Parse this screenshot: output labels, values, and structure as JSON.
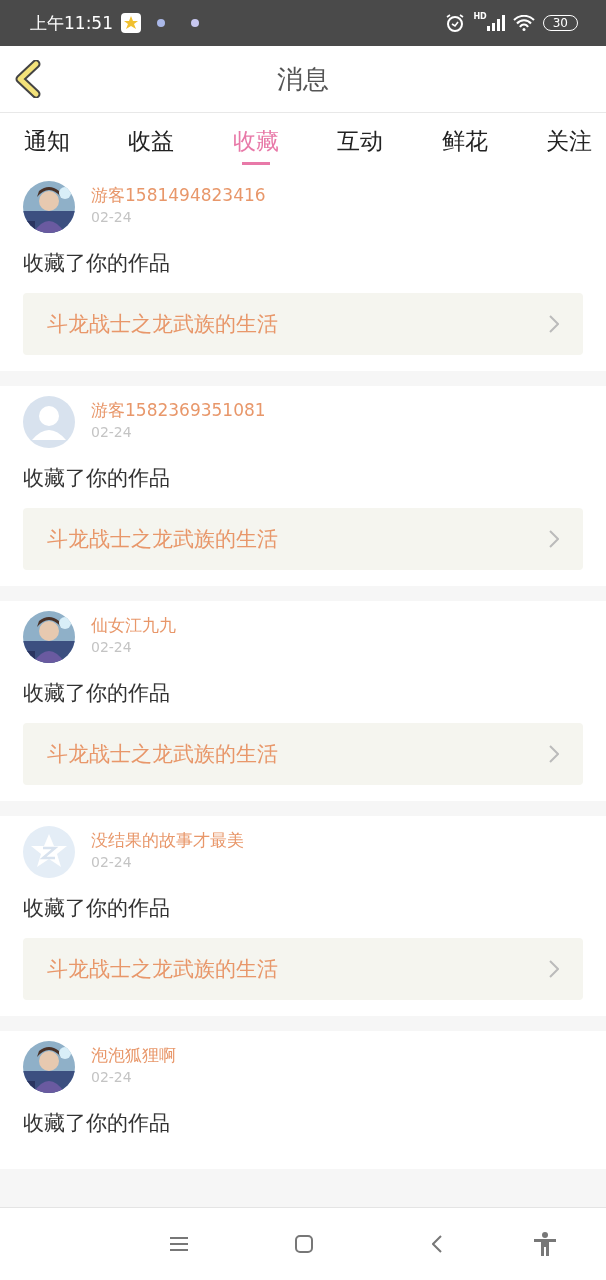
{
  "status_bar": {
    "time": "上午11:51",
    "network": "HD",
    "battery": "30"
  },
  "header": {
    "title": "消息"
  },
  "tabs": [
    {
      "label": "通知",
      "selected": false
    },
    {
      "label": "收益",
      "selected": false
    },
    {
      "label": "收藏",
      "selected": true
    },
    {
      "label": "互动",
      "selected": false
    },
    {
      "label": "鲜花",
      "selected": false
    },
    {
      "label": "关注",
      "selected": false
    }
  ],
  "messages": [
    {
      "kind": "picture",
      "user": "游客1581494823416",
      "date": "02-24",
      "action": "收藏了你的作品",
      "work": "斗龙战士之龙武族的生活"
    },
    {
      "kind": "silhouette",
      "user": "游客1582369351081",
      "date": "02-24",
      "action": "收藏了你的作品",
      "work": "斗龙战士之龙武族的生活"
    },
    {
      "kind": "picture",
      "user": "仙女江九九",
      "date": "02-24",
      "action": "收藏了你的作品",
      "work": "斗龙战士之龙武族的生活"
    },
    {
      "kind": "star",
      "user": "没结果的故事才最美",
      "date": "02-24",
      "action": "收藏了你的作品",
      "work": "斗龙战士之龙武族的生活"
    },
    {
      "kind": "picture",
      "user": "泡泡狐狸啊",
      "date": "02-24",
      "action": "收藏了你的作品"
    }
  ]
}
